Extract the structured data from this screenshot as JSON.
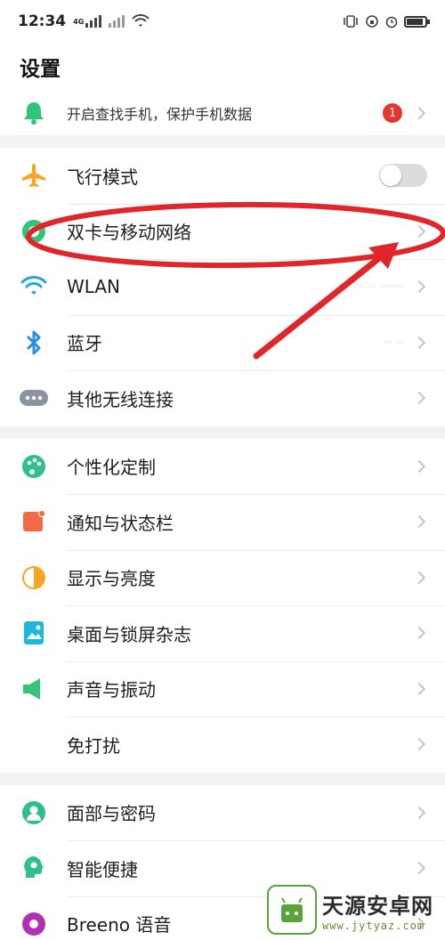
{
  "status": {
    "time": "12:34",
    "net_label": "4G"
  },
  "header": {
    "title": "设置"
  },
  "find_phone": {
    "label": "开启查找手机，保护手机数据",
    "badge": "1"
  },
  "network_group": [
    {
      "key": "airplane",
      "label": "飞行模式",
      "control": "toggle",
      "toggle_on": false,
      "icon": "airplane-icon"
    },
    {
      "key": "sim",
      "label": "双卡与移动网络",
      "control": "chevron",
      "icon": "sim-network-icon"
    },
    {
      "key": "wlan",
      "label": "WLAN",
      "control": "chevron",
      "value": "··· ·· ······",
      "icon": "wifi-icon"
    },
    {
      "key": "bt",
      "label": "蓝牙",
      "control": "chevron",
      "value": "·· ··",
      "icon": "bluetooth-icon"
    },
    {
      "key": "other",
      "label": "其他无线连接",
      "control": "chevron",
      "icon": "wireless-more-icon"
    }
  ],
  "display_group": [
    {
      "key": "personal",
      "label": "个性化定制",
      "icon": "palette-icon"
    },
    {
      "key": "notify",
      "label": "通知与状态栏",
      "icon": "notification-icon"
    },
    {
      "key": "display",
      "label": "显示与亮度",
      "icon": "brightness-icon"
    },
    {
      "key": "desktop",
      "label": "桌面与锁屏杂志",
      "icon": "wallpaper-icon"
    },
    {
      "key": "sound",
      "label": "声音与振动",
      "icon": "sound-icon"
    },
    {
      "key": "dnd",
      "label": "免打扰",
      "icon": "moon-icon"
    }
  ],
  "security_group": [
    {
      "key": "face",
      "label": "面部与密码",
      "icon": "face-lock-icon"
    },
    {
      "key": "smart",
      "label": "智能便捷",
      "icon": "smart-assist-icon"
    },
    {
      "key": "breeno",
      "label": "Breeno 语音",
      "icon": "breeno-icon"
    }
  ],
  "colors": {
    "airplane": "#f5a623",
    "sim": "#2fc47a",
    "wifi": "#1fa8d8",
    "bluetooth": "#2b8fe0",
    "more": "#8c93a0",
    "palette": "#2fbf8f",
    "notify": "#f26a45",
    "display": "#f5a623",
    "desktop": "#20b8d8",
    "sound": "#36c47a",
    "moon": "#9b6be0",
    "face": "#2fbf8f",
    "smart": "#2fbf8f",
    "breeno": "#b12fb8",
    "badge": "#e8352c",
    "annotation": "#e0252b"
  },
  "watermark": {
    "name": "天源安卓网",
    "url": "www.jytyaz.com"
  }
}
